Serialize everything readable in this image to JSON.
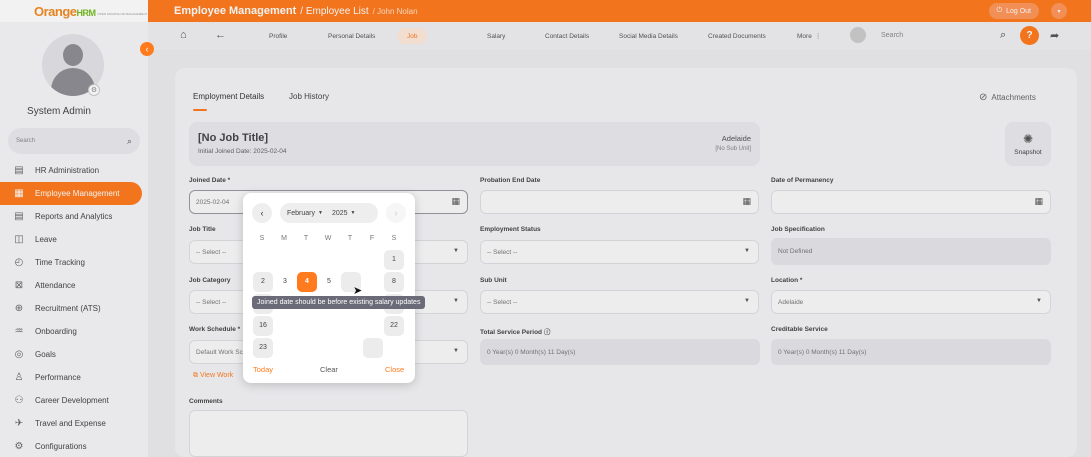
{
  "brand": {
    "logo_text": "Orange",
    "logo_suffix": "HRM",
    "tagline": "OPEN SOURCE HR MANAGEMENT"
  },
  "header": {
    "module": "Employee Management",
    "section": "/ Employee List",
    "leaf": "/ John Nolan",
    "logout_label": "Log Out"
  },
  "sidebar": {
    "user_name": "System Admin",
    "search_placeholder": "Search",
    "items": [
      {
        "label": "HR Administration",
        "icon": "admin-icon"
      },
      {
        "label": "Employee Management",
        "icon": "employee-icon",
        "active": true
      },
      {
        "label": "Reports and Analytics",
        "icon": "reports-icon"
      },
      {
        "label": "Leave",
        "icon": "leave-icon"
      },
      {
        "label": "Time Tracking",
        "icon": "time-icon"
      },
      {
        "label": "Attendance",
        "icon": "attendance-icon"
      },
      {
        "label": "Recruitment (ATS)",
        "icon": "recruitment-icon"
      },
      {
        "label": "Onboarding",
        "icon": "onboarding-icon"
      },
      {
        "label": "Goals",
        "icon": "goals-icon"
      },
      {
        "label": "Performance",
        "icon": "performance-icon"
      },
      {
        "label": "Career Development",
        "icon": "career-icon"
      },
      {
        "label": "Travel and Expense",
        "icon": "travel-icon"
      },
      {
        "label": "Configurations",
        "icon": "config-icon"
      }
    ]
  },
  "tabs": [
    "Profile",
    "Personal Details",
    "Job",
    "Salary",
    "Contact Details",
    "Social Media Details",
    "Created Documents",
    "More"
  ],
  "topsearch_placeholder": "Search",
  "inner_tabs": {
    "details": "Employment Details",
    "history": "Job History",
    "attachments": "Attachments"
  },
  "job_card": {
    "title": "[No Job Title]",
    "joined": "Initial Joined Date: 2025-02-04",
    "location": "Adelaide",
    "sub_unit": "[No Sub Unit]",
    "snapshot_label": "Snapshot"
  },
  "fields": {
    "joined_date_label": "Joined Date *",
    "joined_date_value": "2025-02-04",
    "probation_label": "Probation End Date",
    "permanency_label": "Date of Permanency",
    "job_title_label": "Job Title",
    "job_title_value": "-- Select --",
    "employment_status_label": "Employment Status",
    "employment_status_value": "-- Select --",
    "job_spec_label": "Job Specification",
    "job_spec_value": "Not Defined",
    "job_category_label": "Job Category",
    "job_category_value": "-- Select --",
    "sub_unit_label": "Sub Unit",
    "sub_unit_value": "-- Select --",
    "location_label": "Location *",
    "location_value": "Adelaide",
    "work_schedule_label": "Work Schedule *",
    "work_schedule_value": "Default Work Sc",
    "view_work_label": "View Work",
    "total_service_label": "Total Service Period",
    "total_service_value": "0 Year(s) 0 Month(s) 11 Day(s)",
    "creditable_label": "Creditable Service",
    "creditable_value": "0 Year(s) 0 Month(s) 11 Day(s)",
    "comments_label": "Comments"
  },
  "datepicker": {
    "month": "February",
    "year": "2025",
    "weekdays": [
      "S",
      "M",
      "T",
      "W",
      "T",
      "F",
      "S"
    ],
    "days": [
      "1",
      "2",
      "3",
      "4",
      "5",
      "8",
      "16",
      "22",
      "23"
    ],
    "selected": "4",
    "today_label": "Today",
    "clear_label": "Clear",
    "close_label": "Close",
    "tooltip": "Joined date should be before existing salary updates"
  },
  "colors": {
    "accent": "#ff7b1d",
    "sidebar_active": "#ff7b1d"
  }
}
